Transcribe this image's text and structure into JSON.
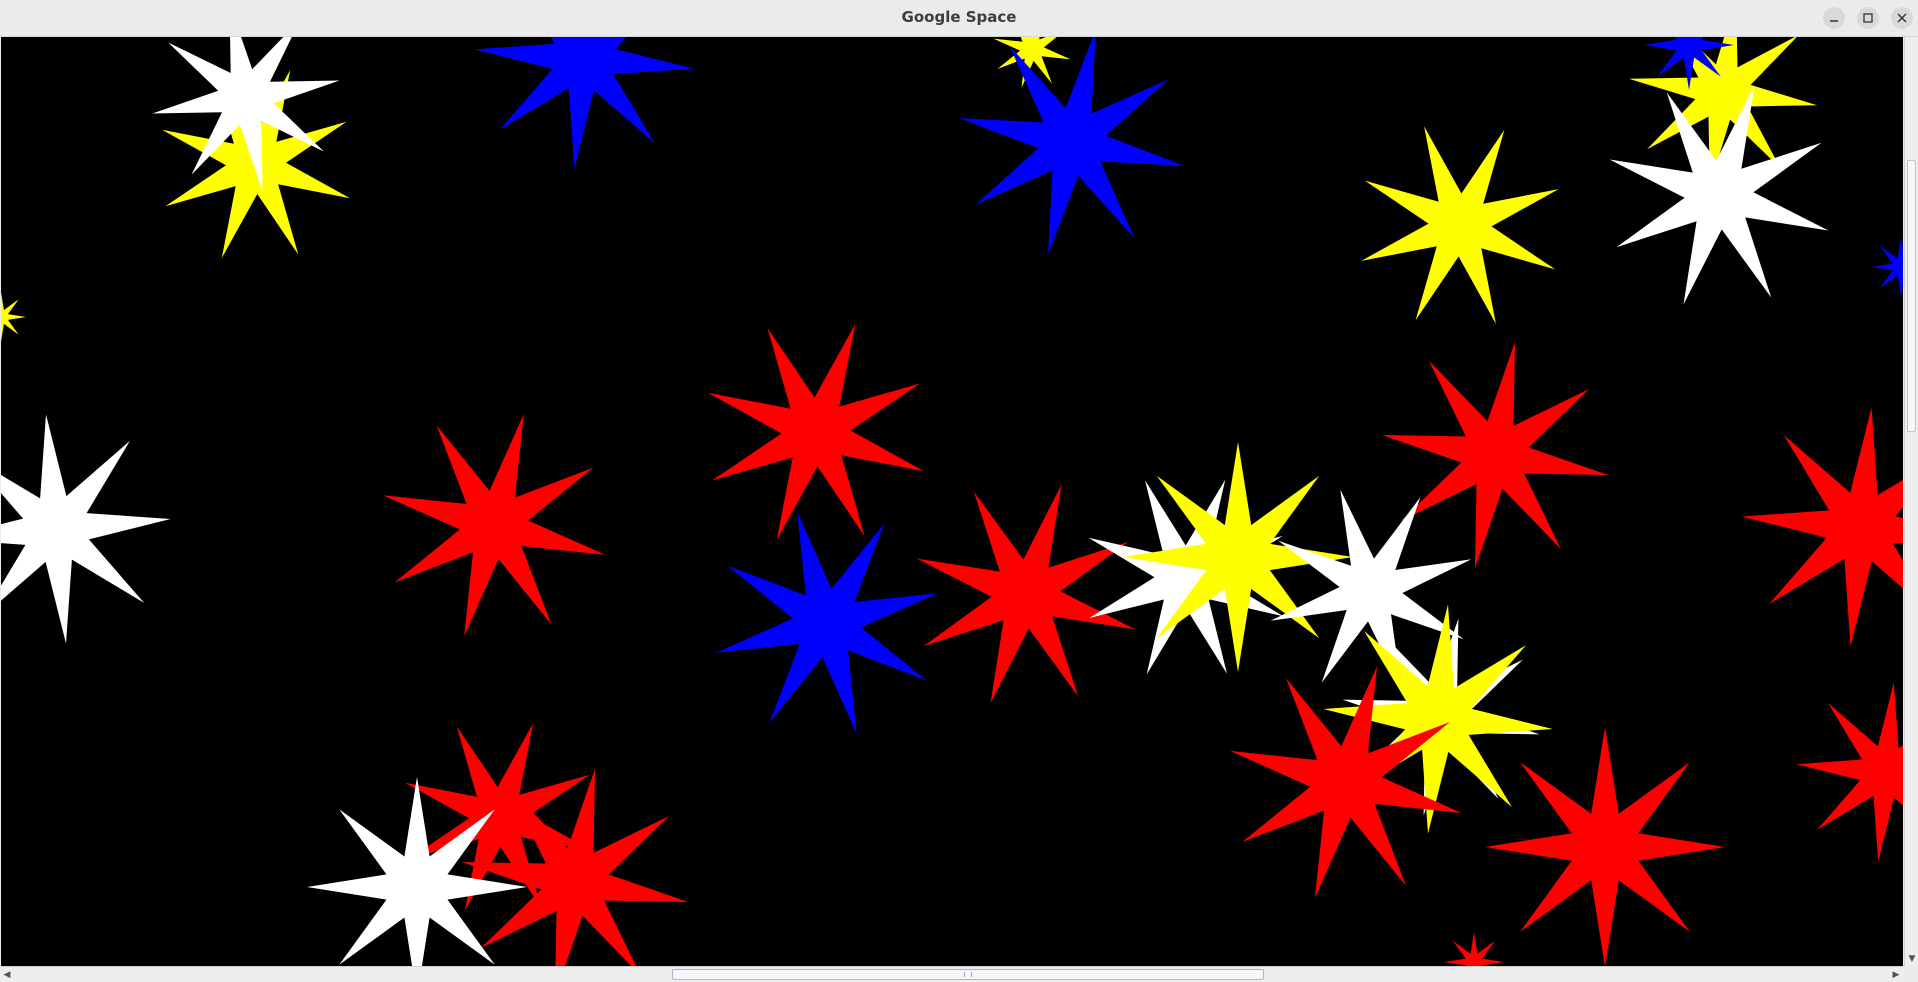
{
  "window": {
    "title": "Google Space",
    "controls": [
      "minimize-icon",
      "maximize-icon",
      "close-icon"
    ]
  },
  "canvas": {
    "background": "#000000",
    "star_colors": {
      "red": "#ff0000",
      "yellow": "#ffff00",
      "white": "#ffffff",
      "blue": "#0000ff"
    }
  },
  "scrollbars": {
    "horizontal_arrows": [
      "◀",
      "▶"
    ],
    "vertical_arrows": [
      "▼"
    ]
  }
}
